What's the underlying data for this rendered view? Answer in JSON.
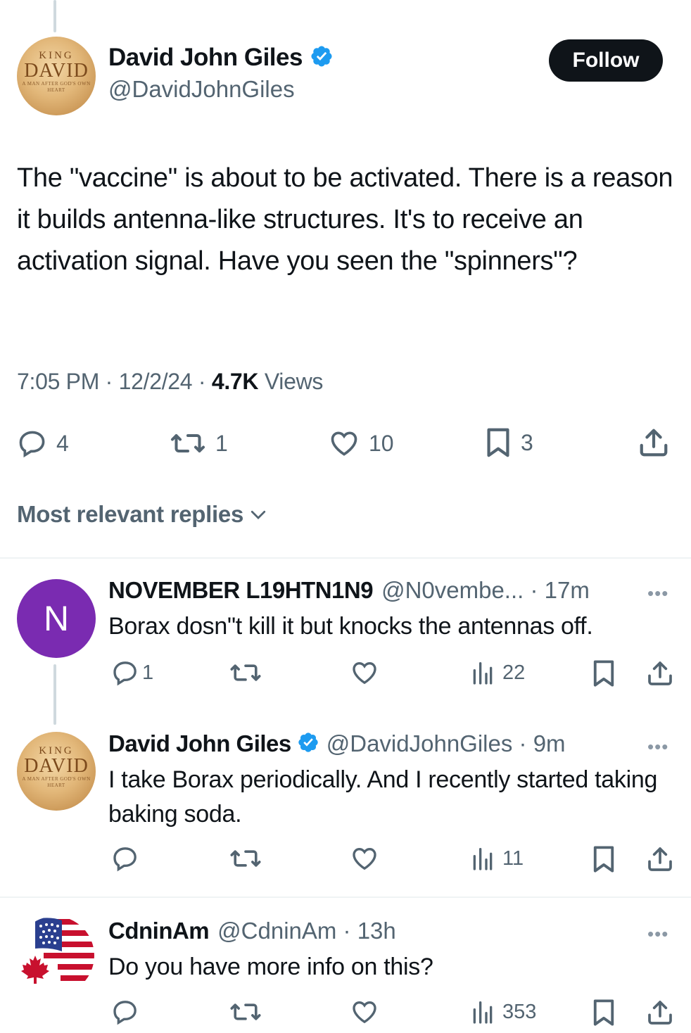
{
  "main_tweet": {
    "author_name": "David John Giles",
    "handle": "@DavidJohnGiles",
    "avatar_text": {
      "line1": "KING",
      "line2": "DAVID",
      "line3": "A MAN AFTER GOD'S OWN HEART"
    },
    "follow_label": "Follow",
    "text": "The \"vaccine\" is about to be activated. There is a reason it builds antenna-like structures. It's to receive an activation signal. Have you seen the \"spinners\"?",
    "time": "7:05 PM",
    "date": "12/2/24",
    "views_count": "4.7K",
    "views_label": "Views",
    "replies": "4",
    "reposts": "1",
    "likes": "10",
    "bookmarks": "3"
  },
  "sort": {
    "label": "Most relevant replies"
  },
  "replies": [
    {
      "avatar_letter": "N",
      "name": "NOVEMBER L19HTN1N9",
      "meta": "@N0vembe... · 17m",
      "text": "Borax dosn\"t kill it but knocks the antennas off.",
      "reply_count": "1",
      "views": "22"
    },
    {
      "name": "David John Giles",
      "meta": "@DavidJohnGiles · 9m",
      "text": "I take Borax periodically. And I recently started taking baking soda.",
      "views": "11"
    },
    {
      "name": "CdninAm",
      "meta": "@CdninAm · 13h",
      "text": "Do you have more info on this?",
      "views": "353"
    }
  ],
  "colors": {
    "text": "#0f1419",
    "secondary": "#536471",
    "verified": "#1d9bf0",
    "avatar_n": "#7a2bb1",
    "follow_bg": "#0f1419"
  },
  "icons": [
    "verified-badge-icon",
    "reply-icon",
    "repost-icon",
    "like-icon",
    "bookmark-icon",
    "share-icon",
    "views-icon",
    "more-icon",
    "chevron-down-icon"
  ]
}
